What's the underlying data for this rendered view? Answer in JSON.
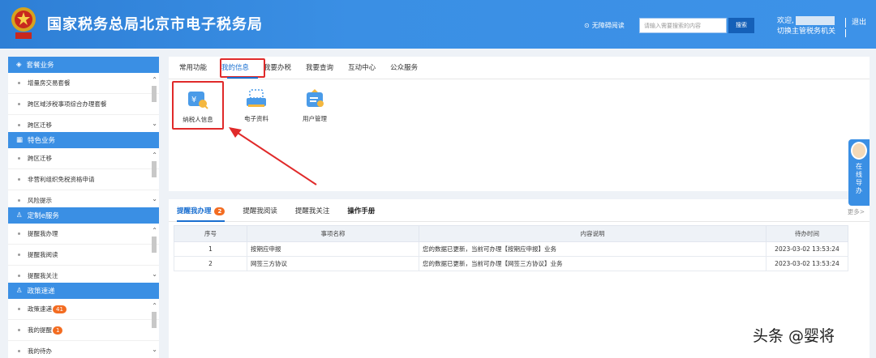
{
  "header": {
    "title": "国家税务总局北京市电子税务局",
    "accessibility": "无障碍阅读",
    "search_placeholder": "请输入需要搜索的内容",
    "search_button": "搜索",
    "welcome": "欢迎,",
    "switch_org": "切换主管税务机关",
    "logout": "退出",
    "colors": {
      "header_bg": "#2e7fd6",
      "accent_red": "#e02a2a"
    }
  },
  "sidebar": {
    "sections": [
      {
        "title": "套餐业务",
        "icon": "layers-icon",
        "items": [
          "增量房交易套餐",
          "跨区域涉税事项综合办理套餐",
          "跨区迁移"
        ]
      },
      {
        "title": "特色业务",
        "icon": "grid-icon",
        "items": [
          "跨区迁移",
          "非营利组织免税资格申请",
          "风险提示"
        ]
      },
      {
        "title": "定制e服务",
        "icon": "user-icon",
        "items": [
          "提醒我办理",
          "提醒我阅读",
          "提醒我关注"
        ]
      },
      {
        "title": "政策速递",
        "icon": "user-icon",
        "items": [
          "政策速递",
          "我的提醒",
          "我的待办"
        ],
        "badges": [
          "41",
          "1",
          ""
        ]
      }
    ]
  },
  "main": {
    "tabs": [
      "常用功能",
      "我的信息",
      "我要办税",
      "我要查询",
      "互动中心",
      "公众服务"
    ],
    "active_tab": "我的信息",
    "icons": [
      {
        "label": "纳税人信息",
        "icon": "taxpayer-info-icon"
      },
      {
        "label": "电子资料",
        "icon": "e-document-icon"
      },
      {
        "label": "用户管理",
        "icon": "user-management-icon"
      }
    ]
  },
  "reminders": {
    "tabs": [
      {
        "label": "提醒我办理",
        "badge": "2"
      },
      {
        "label": "提醒我阅读"
      },
      {
        "label": "提醒我关注"
      },
      {
        "label": "操作手册"
      }
    ],
    "more": "更多>",
    "columns": [
      "序号",
      "事项名称",
      "内容说明",
      "待办时间"
    ],
    "rows": [
      [
        "1",
        "按期应申报",
        "您的数据已更新，当前可办理【按期应申报】业务",
        "2023-03-02 13:53:24"
      ],
      [
        "2",
        "网签三方协议",
        "您的数据已更新，当前可办理【网签三方协议】业务",
        "2023-03-02 13:53:24"
      ]
    ]
  },
  "helper": {
    "label": "在线导办"
  },
  "watermark": "头条 @婴将"
}
